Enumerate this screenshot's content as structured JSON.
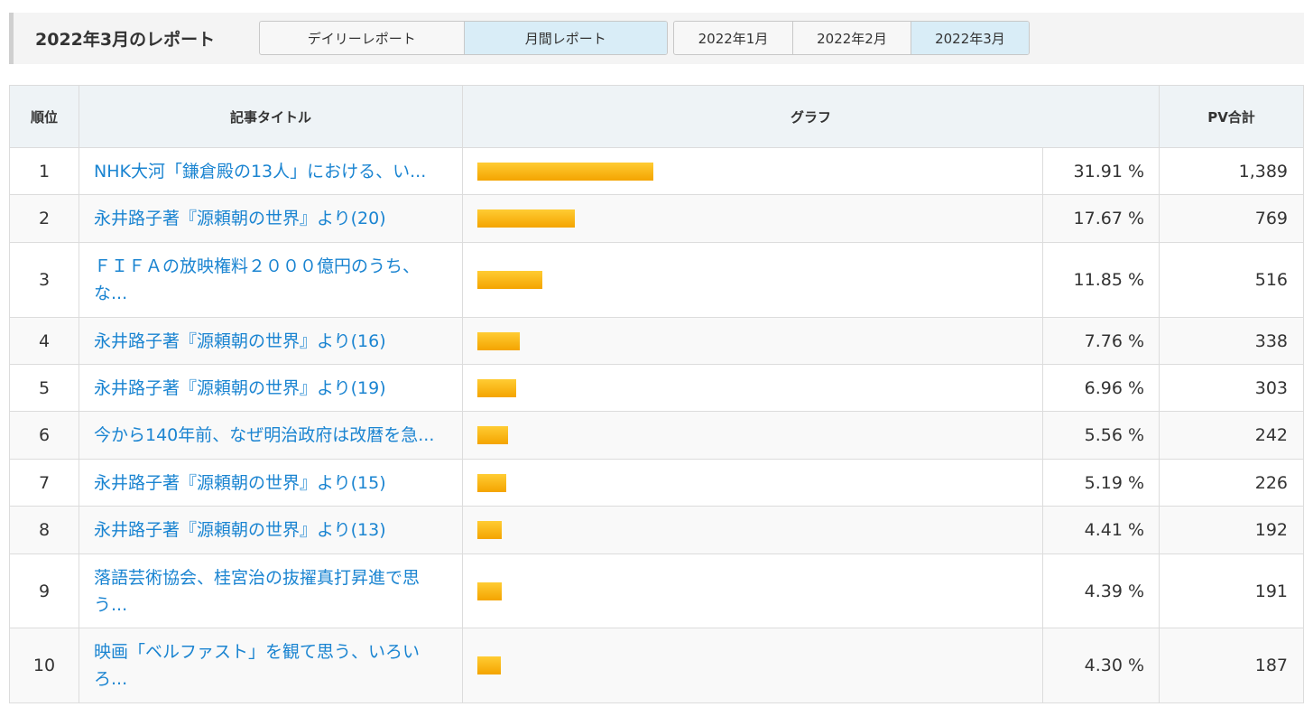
{
  "header": {
    "title": "2022年3月のレポート",
    "report_tabs": [
      {
        "label": "デイリーレポート",
        "active": false
      },
      {
        "label": "月間レポート",
        "active": true
      }
    ],
    "month_tabs": [
      {
        "label": "2022年1月",
        "active": false
      },
      {
        "label": "2022年2月",
        "active": false
      },
      {
        "label": "2022年3月",
        "active": true
      }
    ]
  },
  "table": {
    "columns": {
      "rank": "順位",
      "title": "記事タイトル",
      "graph": "グラフ",
      "pv": "PV合計"
    },
    "rows": [
      {
        "rank": "1",
        "title": "NHK大河「鎌倉殿の13人」における、い...",
        "percent": "31.91 %",
        "pv": "1,389",
        "share": 31.91
      },
      {
        "rank": "2",
        "title": "永井路子著『源頼朝の世界』より(20)",
        "percent": "17.67 %",
        "pv": "769",
        "share": 17.67
      },
      {
        "rank": "3",
        "title": "ＦＩＦＡの放映権料２０００億円のうち、な...",
        "percent": "11.85 %",
        "pv": "516",
        "share": 11.85
      },
      {
        "rank": "4",
        "title": "永井路子著『源頼朝の世界』より(16)",
        "percent": "7.76 %",
        "pv": "338",
        "share": 7.76
      },
      {
        "rank": "5",
        "title": "永井路子著『源頼朝の世界』より(19)",
        "percent": "6.96 %",
        "pv": "303",
        "share": 6.96
      },
      {
        "rank": "6",
        "title": "今から140年前、なぜ明治政府は改暦を急...",
        "percent": "5.56 %",
        "pv": "242",
        "share": 5.56
      },
      {
        "rank": "7",
        "title": "永井路子著『源頼朝の世界』より(15)",
        "percent": "5.19 %",
        "pv": "226",
        "share": 5.19
      },
      {
        "rank": "8",
        "title": "永井路子著『源頼朝の世界』より(13)",
        "percent": "4.41 %",
        "pv": "192",
        "share": 4.41
      },
      {
        "rank": "9",
        "title": "落語芸術協会、桂宮治の抜擢真打昇進で思う...",
        "percent": "4.39 %",
        "pv": "191",
        "share": 4.39
      },
      {
        "rank": "10",
        "title": "映画「ベルファスト」を観て思う、いろいろ...",
        "percent": "4.30 %",
        "pv": "187",
        "share": 4.3
      }
    ],
    "bar_color": "#f4a400"
  }
}
